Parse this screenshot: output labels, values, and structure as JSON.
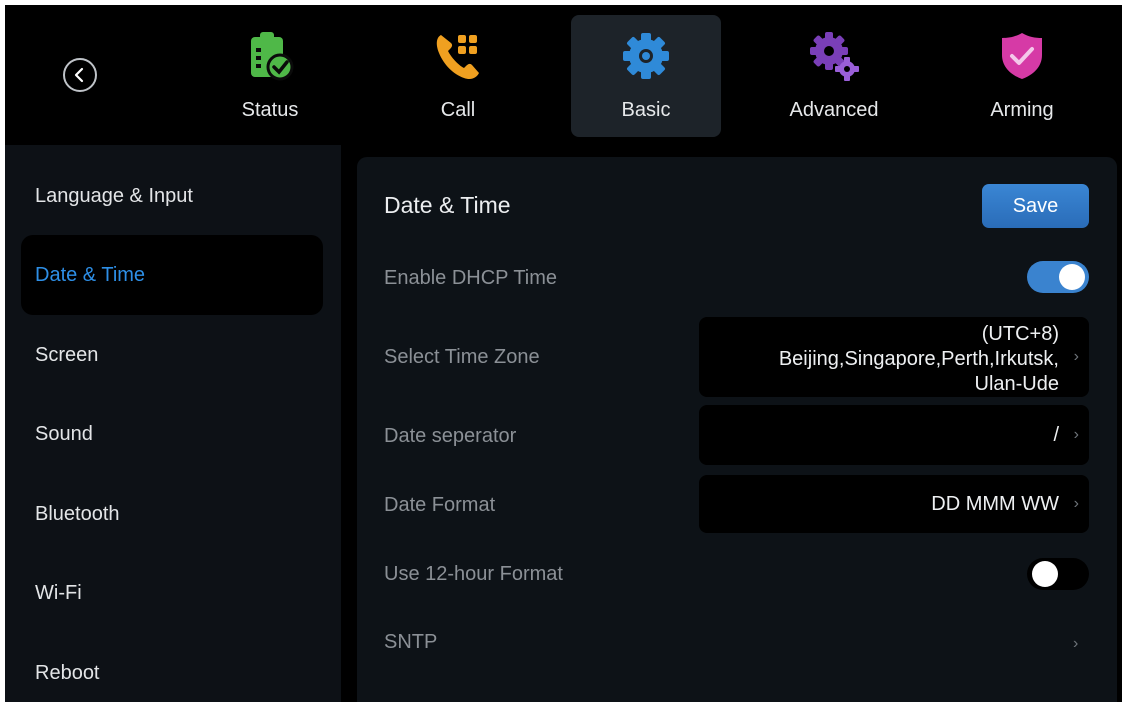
{
  "nav": {
    "tabs": [
      {
        "label": "Status",
        "icon": "clipboard-check-icon",
        "color": "#4fb848"
      },
      {
        "label": "Call",
        "icon": "phone-grid-icon",
        "color": "#f0a020"
      },
      {
        "label": "Basic",
        "icon": "gear-icon",
        "color": "#2f8ad8",
        "active": true
      },
      {
        "label": "Advanced",
        "icon": "gears-icon",
        "color": "#7a3fb8"
      },
      {
        "label": "Arming",
        "icon": "shield-check-icon",
        "color": "#d63aa6"
      }
    ]
  },
  "sidebar": {
    "items": [
      {
        "label": "Language & Input"
      },
      {
        "label": "Date & Time",
        "active": true
      },
      {
        "label": "Screen"
      },
      {
        "label": "Sound"
      },
      {
        "label": "Bluetooth"
      },
      {
        "label": "Wi-Fi"
      },
      {
        "label": "Reboot"
      }
    ]
  },
  "content": {
    "title": "Date & Time",
    "save_label": "Save",
    "rows": {
      "dhcp": {
        "label": "Enable DHCP Time",
        "enabled": true
      },
      "timezone": {
        "label": "Select Time Zone",
        "value_line1": "(UTC+8)",
        "value_line2": "Beijing,Singapore,Perth,Irkutsk,",
        "value_line3": "Ulan-Ude"
      },
      "separator": {
        "label": "Date seperator",
        "value": "/"
      },
      "format": {
        "label": "Date Format",
        "value": "DD MMM WW"
      },
      "hour12": {
        "label": "Use 12-hour Format",
        "enabled": false
      },
      "sntp": {
        "label": "SNTP"
      }
    },
    "chevron": "›"
  },
  "colors": {
    "accent": "#2e8fe6",
    "toggle_on": "#3a83cf"
  }
}
